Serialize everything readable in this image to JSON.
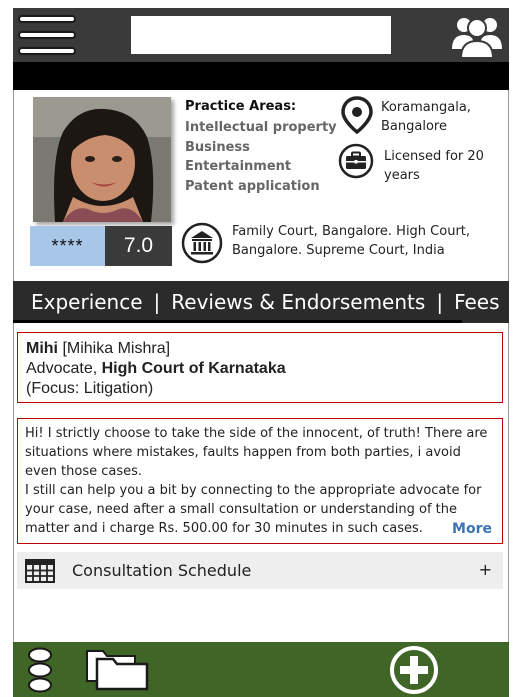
{
  "header": {
    "menu_icon": "hamburger-menu-icon",
    "search_value": "",
    "group_icon": "user-group-icon"
  },
  "profile": {
    "photo": "profile-photo",
    "rating_stars": "****",
    "score": "7.0",
    "practice_areas_title": "Practice Areas:",
    "practice_areas": [
      "Intellectual property",
      "Business",
      "Entertainment",
      "Patent application"
    ],
    "location_line1": "Koramangala,",
    "location_line2": "Bangalore",
    "license_line1": "Licensed for 20",
    "license_line2": "years",
    "courts_line1": "Family Court, Bangalore. High Court,",
    "courts_line2": "Bangalore. Supreme Court, India"
  },
  "tabs": [
    {
      "label": "Experience"
    },
    {
      "label": "Reviews & Endorsements"
    },
    {
      "label": "Fees"
    }
  ],
  "tab_separator": "|",
  "lawyer": {
    "short_name": "Mihi",
    "full_name": "[Mihika Mishra]",
    "title": "Advocate,",
    "court": "High Court of Karnataka",
    "focus": "(Focus: Litigation)"
  },
  "bio": {
    "lines": [
      "Hi! I strictly choose  to take the side of the innocent, of truth! There are",
      "situations where mistakes, faults happen from both  parties, i avoid",
      "even those cases.",
      "I still can help you a bit by connecting to the appropriate advocate for",
      "your case, need after a small consultation or understanding of the",
      "matter and i charge Rs. 500.00 for 30 minutes in such cases."
    ],
    "more_label": "More"
  },
  "consultation": {
    "label": "Consultation Schedule",
    "expand_symbol": "+"
  },
  "footer": {
    "icons": [
      "more-dots-icon",
      "folders-icon",
      "add-circle-icon"
    ]
  },
  "colors": {
    "topbar": "#3a3a3a",
    "tabbar": "#2b2b2b",
    "footer": "#3f6527",
    "rating_bg": "#a7c6e8",
    "border_red": "#c00000",
    "link_blue": "#3c75b5"
  }
}
